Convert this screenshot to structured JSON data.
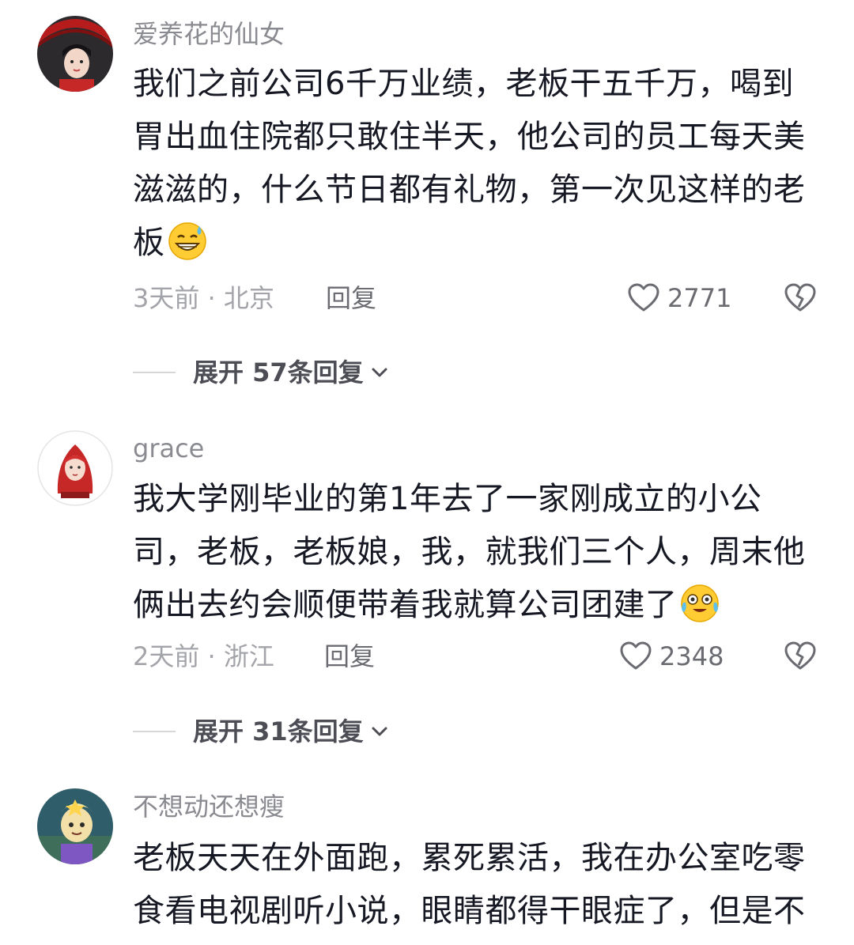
{
  "comments": [
    {
      "username": "爱养花的仙女",
      "text": "我们之前公司6千万业绩，老板干五千万，喝到胃出血住院都只敢住半天，他公司的员工每天美滋滋的，什么节日都有礼物，第一次见这样的老板",
      "emoji": "sweat-smile-emoji",
      "time_location": "3天前 · 北京",
      "reply_label": "回复",
      "likes": "2771",
      "expand_label": "展开 57条回复"
    },
    {
      "username": "grace",
      "text": "我大学刚毕业的第1年去了一家刚成立的小公司，老板，老板娘，我，就我们三个人，周末他俩出去约会顺便带着我就算公司团建了",
      "emoji": "crying-laughing-emoji",
      "time_location": "2天前 · 浙江",
      "reply_label": "回复",
      "likes": "2348",
      "expand_label": "展开 31条回复"
    },
    {
      "username": "不想动还想瘦",
      "text": "老板天天在外面跑，累死累活，我在办公室吃零食看电视剧听小说，眼睛都得干眼症了，但是不"
    }
  ],
  "icons": {
    "like": "heart-outline-icon",
    "dislike": "broken-heart-icon",
    "expand": "chevron-down-icon"
  },
  "colors": {
    "username": "#8a8b91",
    "body": "#161823",
    "meta": "#a3a4a9"
  }
}
